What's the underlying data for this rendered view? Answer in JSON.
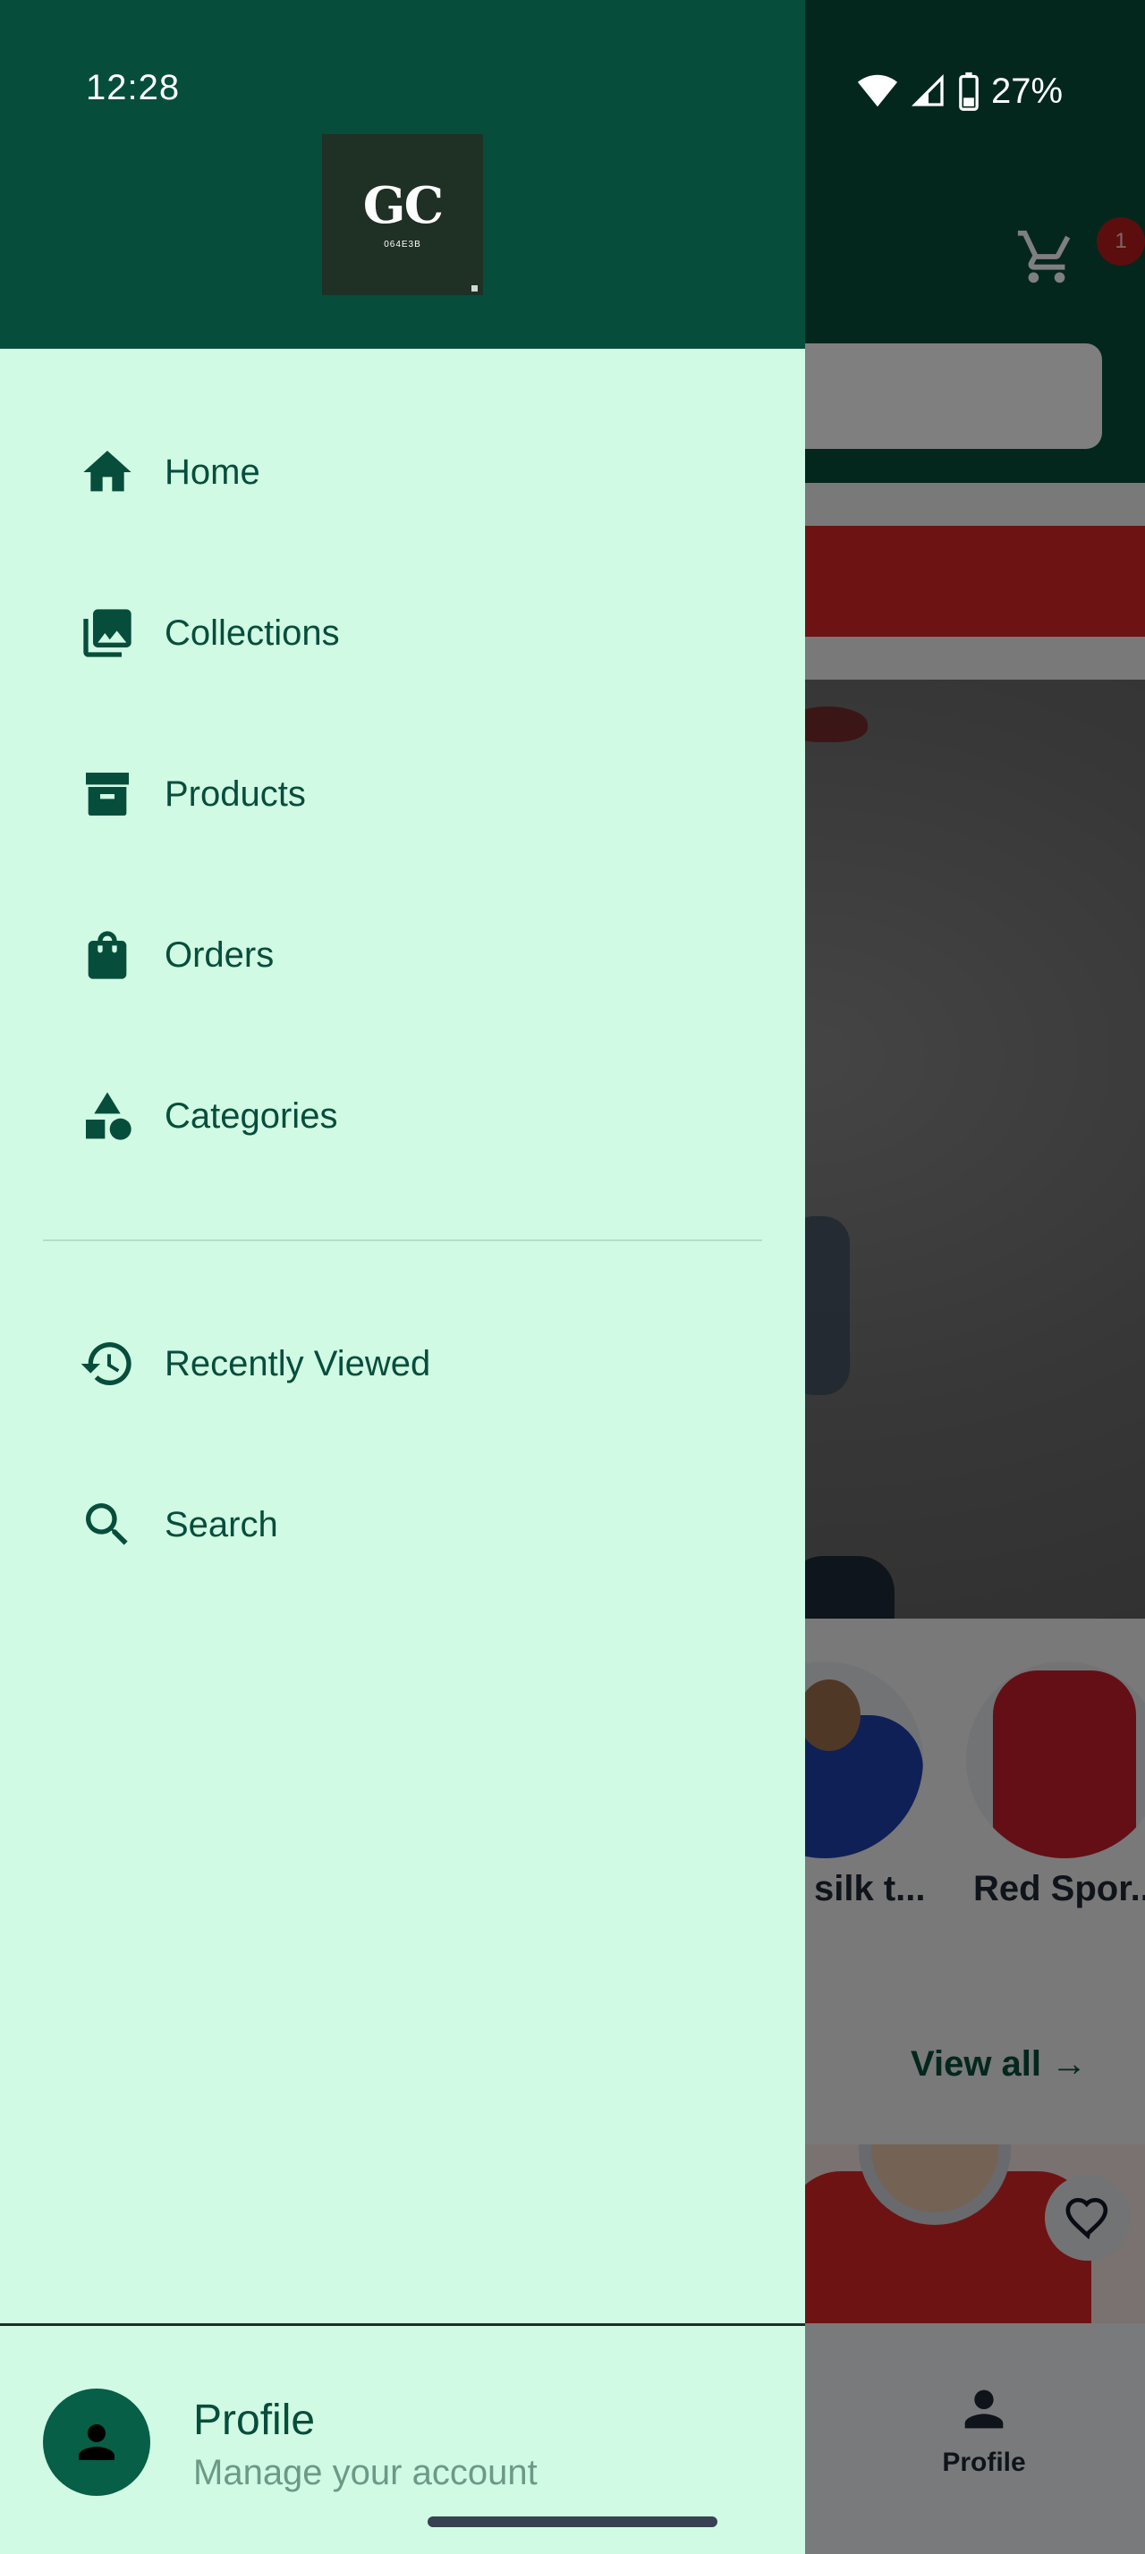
{
  "status_bar": {
    "time": "12:28",
    "battery": "27%"
  },
  "background": {
    "cart_badge": "1",
    "circle_labels": [
      "silk t...",
      "Red Spor..."
    ],
    "view_all": "View all",
    "bottom_nav_profile": "Profile"
  },
  "drawer": {
    "logo": {
      "mark": "GC",
      "subtext": "064E3B"
    },
    "items": [
      {
        "label": "Home",
        "icon": "home-icon"
      },
      {
        "label": "Collections",
        "icon": "photo-library-icon"
      },
      {
        "label": "Products",
        "icon": "archive-box-icon"
      },
      {
        "label": "Orders",
        "icon": "shopping-bag-icon"
      },
      {
        "label": "Categories",
        "icon": "category-shapes-icon"
      }
    ],
    "secondary_items": [
      {
        "label": "Recently Viewed",
        "icon": "history-icon"
      },
      {
        "label": "Search",
        "icon": "search-icon"
      }
    ],
    "profile": {
      "title": "Profile",
      "subtitle": "Manage your account"
    }
  },
  "colors": {
    "primary": "#064e3b",
    "drawer_bg": "#d1fae5",
    "badge": "#b91c1c",
    "banner": "#dc2626"
  }
}
